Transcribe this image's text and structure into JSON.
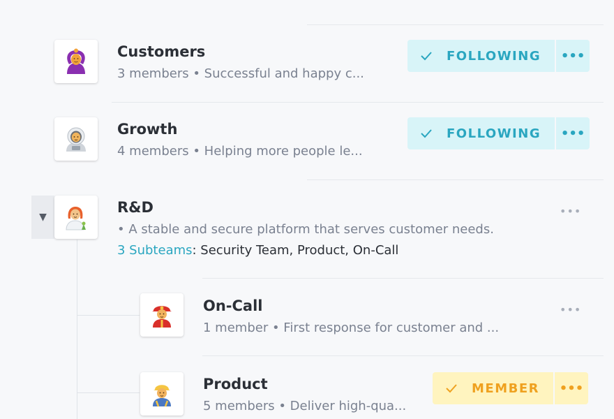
{
  "teams": [
    {
      "name": "Customers",
      "members": "3 members",
      "description": "Successful and happy c...",
      "action": "FOLLOWING",
      "avatar": "woman-gesturing-ok-icon"
    },
    {
      "name": "Growth",
      "members": "4 members",
      "description": "Helping more people le...",
      "action": "FOLLOWING",
      "avatar": "astronaut-icon"
    },
    {
      "name": "R&D",
      "members": "",
      "description": "• A stable and secure platform that serves customer needs.",
      "subteams_link": "3 Subteams",
      "subteams_list": ": Security Team, Product, On-Call",
      "avatar": "woman-farmer-icon"
    }
  ],
  "subteams": [
    {
      "name": "On-Call",
      "members": "1 member",
      "description": "First response for customer and ...",
      "avatar": "firefighter-icon"
    },
    {
      "name": "Product",
      "members": "5 members",
      "description": "Deliver high-qua...",
      "action": "MEMBER",
      "avatar": "construction-worker-icon"
    }
  ],
  "separator": " • ",
  "more_label": "•••",
  "expand_glyph": "▼",
  "colors": {
    "following_bg": "#d8f4f8",
    "following_text": "#2aa6c0",
    "member_bg": "#fff4bf",
    "member_text": "#efa11f",
    "link": "#2aa6c0"
  }
}
